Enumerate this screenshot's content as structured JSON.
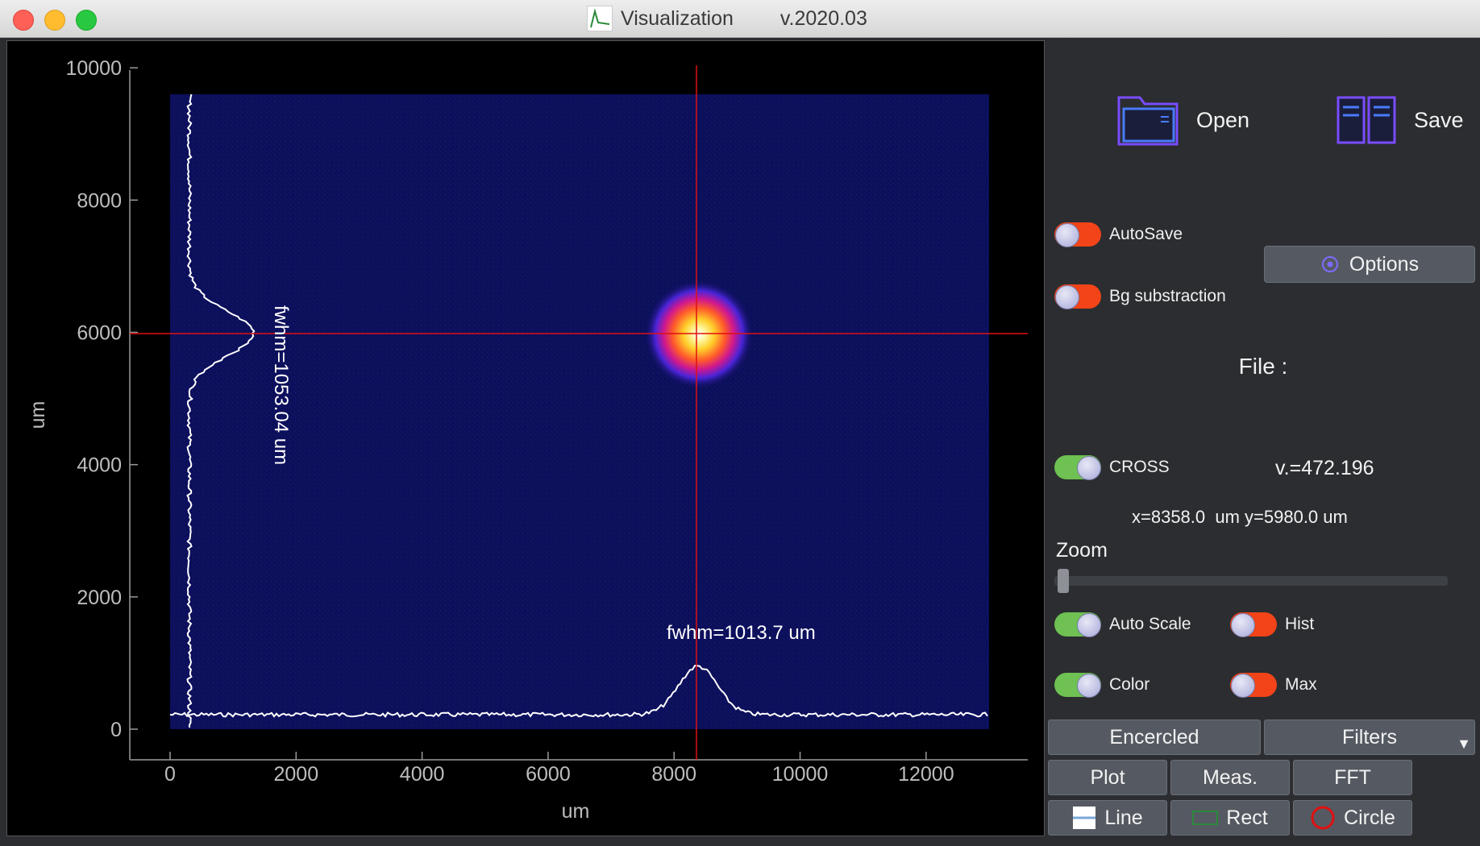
{
  "window": {
    "title": "Visualization",
    "version": "v.2020.03"
  },
  "plot": {
    "xlabel": "um",
    "ylabel": "um",
    "x_ticks": [
      "0",
      "2000",
      "4000",
      "6000",
      "8000",
      "10000",
      "12000"
    ],
    "y_ticks": [
      "0",
      "2000",
      "4000",
      "6000",
      "8000",
      "10000"
    ],
    "fwhm_x": "fwhm=1013.7 um",
    "fwhm_y": "fwhm=1053.04 um",
    "cross_x": 8358.0,
    "cross_y": 5980.0,
    "beam_center": [
      8358,
      5980
    ],
    "colors": {
      "background": "#0c0f5a",
      "cross": "#e01010",
      "profile": "#ffffff"
    }
  },
  "panel": {
    "open_label": "Open",
    "save_label": "Save",
    "autosave_label": "AutoSave",
    "bg_label": "Bg substraction",
    "options_label": "Options",
    "file_label": "File :",
    "cross_label": "CROSS",
    "value_text": "v.=472.196",
    "coord_text": "x=8358.0  um y=5980.0 um",
    "zoom_label": "Zoom",
    "autoscale_label": "Auto Scale",
    "hist_label": "Hist",
    "color_label": "Color",
    "max_label": "Max",
    "encercled_label": "Encercled",
    "filters_label": "Filters",
    "plot_label": "Plot",
    "meas_label": "Meas.",
    "fft_label": "FFT",
    "line_label": "Line",
    "rect_label": "Rect",
    "circle_label": "Circle",
    "toggles": {
      "autosave": false,
      "bg": false,
      "cross": true,
      "autoscale": true,
      "hist": false,
      "color": true,
      "max": false
    },
    "zoom_level": 0
  }
}
